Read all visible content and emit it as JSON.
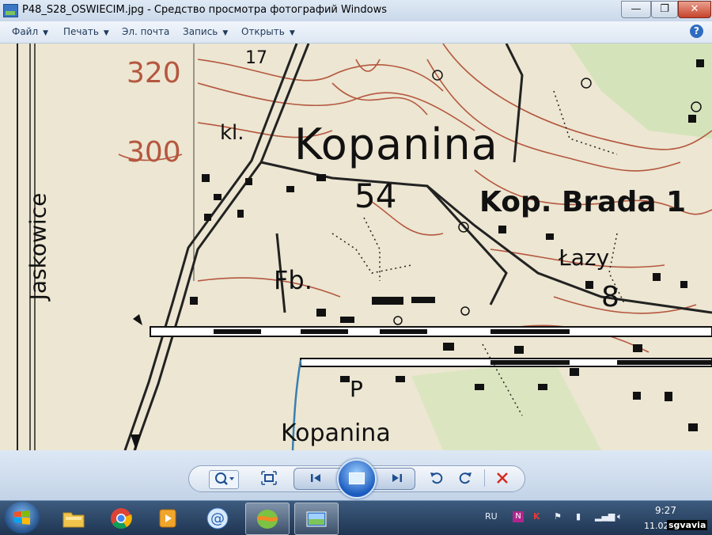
{
  "window": {
    "title": "P48_S28_OSWIECIM.jpg - Средство просмотра фотографий Windows",
    "minimize_glyph": "—",
    "maximize_glyph": "❐",
    "close_glyph": "✕"
  },
  "menu": [
    {
      "label": "Файл",
      "has_arrow": true
    },
    {
      "label": "Печать",
      "has_arrow": true
    },
    {
      "label": "Эл. почта",
      "has_arrow": false
    },
    {
      "label": "Запись",
      "has_arrow": true
    },
    {
      "label": "Открыть",
      "has_arrow": true
    }
  ],
  "menu_arrow": "▼",
  "help_glyph": "?",
  "map": {
    "contour_320": "320",
    "contour_300": "300",
    "jaskowice": "Jaskowice",
    "kopanina_big": "Kopanina",
    "kl": "kl.",
    "num_54": "54",
    "kop_brada": "Kop. Brada 1",
    "lazy": "Łazy",
    "num_8": "8",
    "fb": "Fb.",
    "p": "P",
    "kopanina_small": "Kopanina",
    "num_17": "17"
  },
  "controls": {
    "zoom_icon": "magnifier-icon",
    "fit_icon": "actual-size-icon",
    "prev_icon": "previous-icon",
    "slideshow_icon": "slideshow-icon",
    "next_icon": "next-icon",
    "rotate_ccw_icon": "rotate-left-icon",
    "rotate_cw_icon": "rotate-right-icon",
    "delete_icon": "delete-icon"
  },
  "taskbar": {
    "language": "RU",
    "time": "9:27",
    "date": "11.02",
    "watermark": "sgvavia"
  },
  "colors": {
    "contour_brown": "#b5573f",
    "map_paper": "#ece6d2",
    "forest_green": "#cfe2b5"
  }
}
